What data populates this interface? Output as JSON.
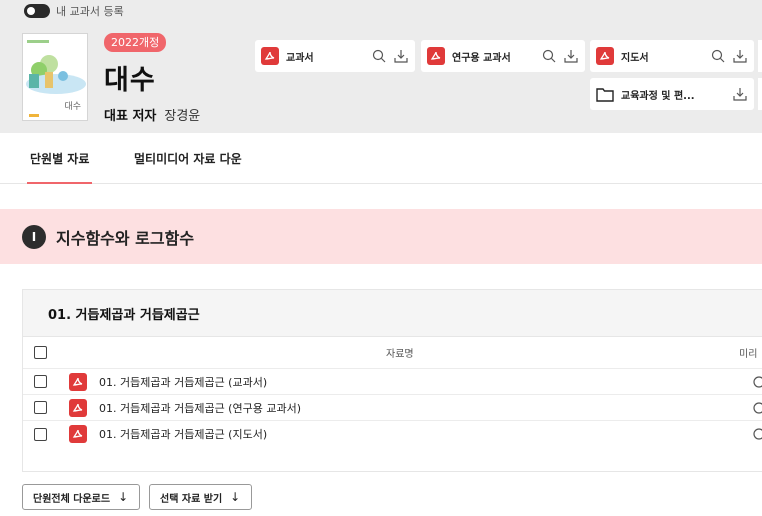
{
  "header": {
    "toggle_label": "내 교과서 등록",
    "badge": "2022개정",
    "title": "대수",
    "author_label": "대표 저자",
    "author_name": "장경윤",
    "cover_text": "대수"
  },
  "resources": [
    {
      "label": "교과서",
      "icon": "pdf-icon"
    },
    {
      "label": "연구용 교과서",
      "icon": "pdf-icon"
    },
    {
      "label": "지도서",
      "icon": "pdf-icon"
    },
    {
      "label": "교육과정 및 편...",
      "icon": "folder-icon"
    }
  ],
  "tabs": [
    {
      "label": "단원별 자료",
      "active": true
    },
    {
      "label": "멀티미디어 자료 다운",
      "active": false
    }
  ],
  "chapter": {
    "number": "I",
    "title": "지수함수와 로그함수"
  },
  "section": {
    "title": "01. 거듭제곱과 거듭제곱근",
    "columns": {
      "name": "자료명",
      "preview": "미리"
    },
    "rows": [
      {
        "label": "01. 거듭제곱과 거듭제곱근 (교과서)"
      },
      {
        "label": "01. 거듭제곱과 거듭제곱근 (연구용 교과서)"
      },
      {
        "label": "01. 거듭제곱과 거듭제곱근 (지도서)"
      }
    ]
  },
  "buttons": {
    "unit_download": "단원전체 다운로드",
    "selected_download": "선택 자료 받기",
    "arrow": "↓"
  },
  "colors": {
    "accent": "#f0666b",
    "pdf_red": "#e03a3a",
    "chapter_bg": "#fde0e1",
    "header_bg": "#ececec"
  }
}
